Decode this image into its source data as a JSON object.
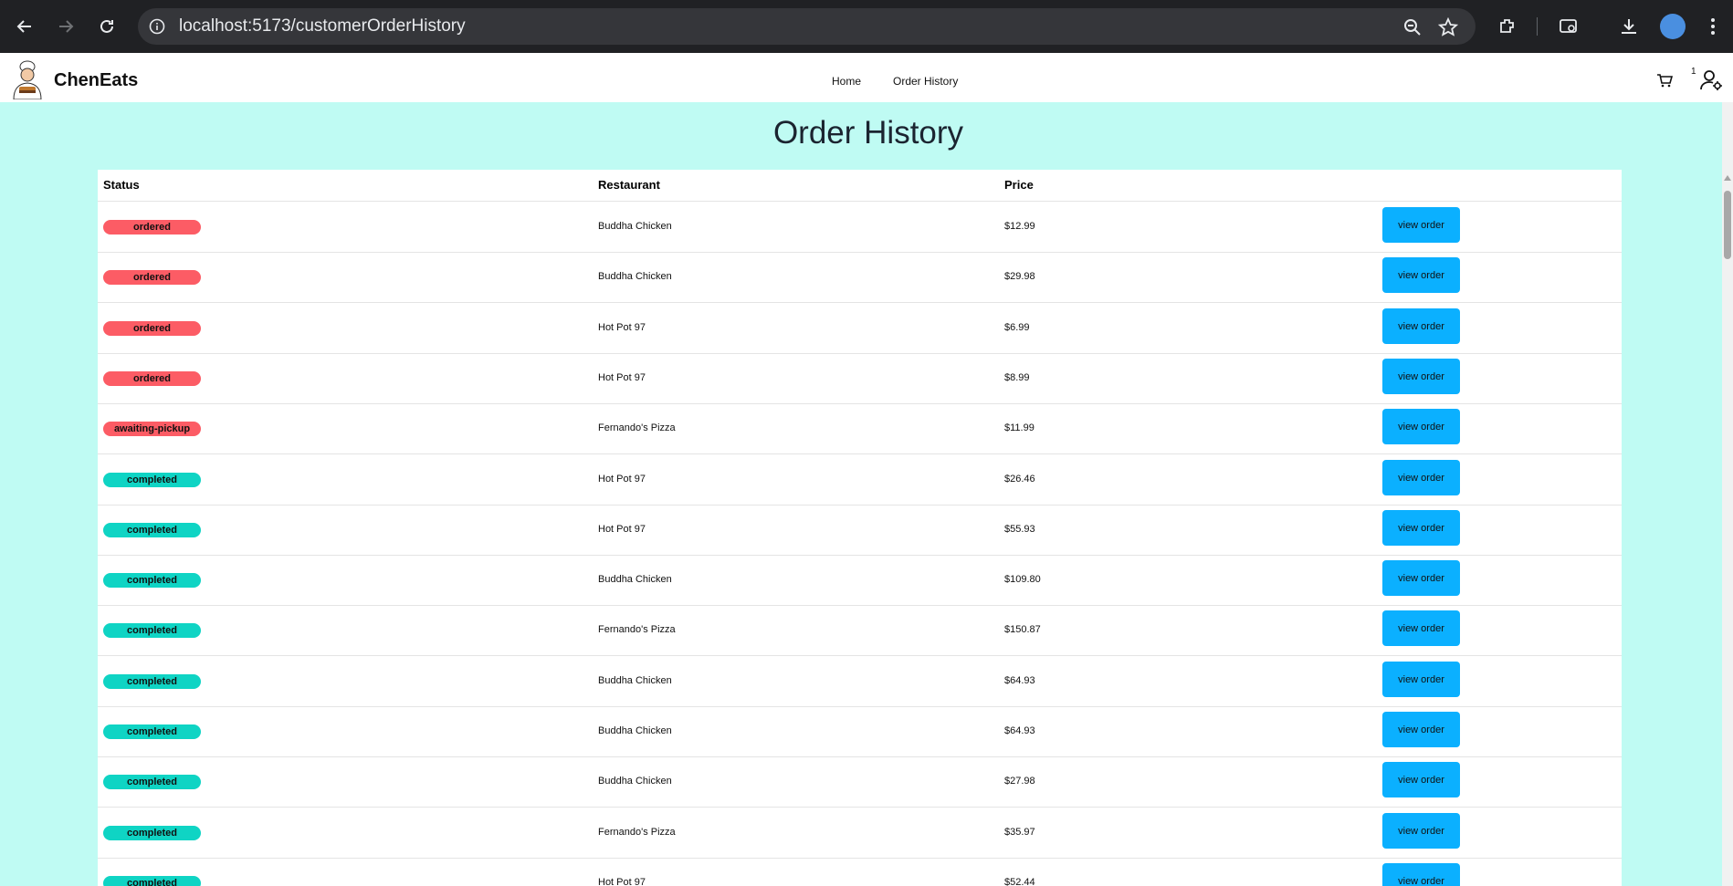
{
  "browser": {
    "url": "localhost:5173/customerOrderHistory"
  },
  "header": {
    "brand": "ChenEats",
    "nav": [
      "Home",
      "Order History"
    ],
    "cart_count": "1"
  },
  "page": {
    "title": "Order History"
  },
  "table": {
    "columns": [
      "Status",
      "Restaurant",
      "Price"
    ],
    "action_label": "view order",
    "status_colors": {
      "ordered": "#fc5c65",
      "awaiting-pickup": "#fc5c65",
      "completed": "#0fd4c4"
    },
    "rows": [
      {
        "status": "ordered",
        "restaurant": "Buddha Chicken",
        "price": "$12.99"
      },
      {
        "status": "ordered",
        "restaurant": "Buddha Chicken",
        "price": "$29.98"
      },
      {
        "status": "ordered",
        "restaurant": "Hot Pot 97",
        "price": "$6.99"
      },
      {
        "status": "ordered",
        "restaurant": "Hot Pot 97",
        "price": "$8.99"
      },
      {
        "status": "awaiting-pickup",
        "restaurant": "Fernando's Pizza",
        "price": "$11.99"
      },
      {
        "status": "completed",
        "restaurant": "Hot Pot 97",
        "price": "$26.46"
      },
      {
        "status": "completed",
        "restaurant": "Hot Pot 97",
        "price": "$55.93"
      },
      {
        "status": "completed",
        "restaurant": "Buddha Chicken",
        "price": "$109.80"
      },
      {
        "status": "completed",
        "restaurant": "Fernando's Pizza",
        "price": "$150.87"
      },
      {
        "status": "completed",
        "restaurant": "Buddha Chicken",
        "price": "$64.93"
      },
      {
        "status": "completed",
        "restaurant": "Buddha Chicken",
        "price": "$64.93"
      },
      {
        "status": "completed",
        "restaurant": "Buddha Chicken",
        "price": "$27.98"
      },
      {
        "status": "completed",
        "restaurant": "Fernando's Pizza",
        "price": "$35.97"
      },
      {
        "status": "completed",
        "restaurant": "Hot Pot 97",
        "price": "$52.44"
      }
    ]
  }
}
